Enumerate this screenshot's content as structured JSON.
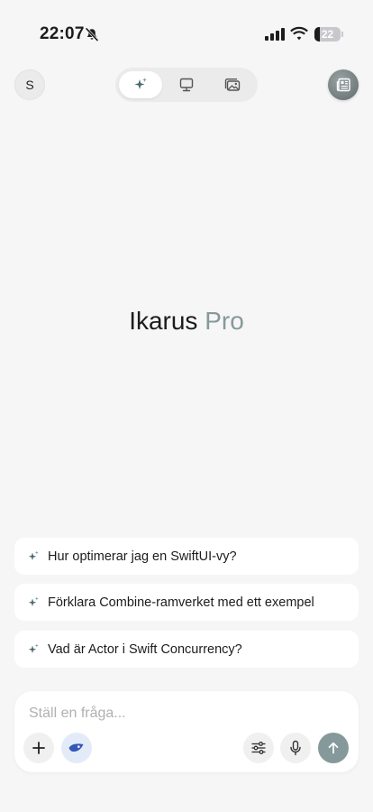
{
  "status_bar": {
    "time": "22:07",
    "battery": "22",
    "battery_level": 0.22
  },
  "header": {
    "avatar_initial": "S",
    "modes": [
      {
        "name": "chat",
        "icon": "sparkle-icon",
        "active": true
      },
      {
        "name": "desktop",
        "icon": "monitor-icon",
        "active": false
      },
      {
        "name": "images",
        "icon": "photos-icon",
        "active": false
      }
    ],
    "right_icon": "newspaper-icon"
  },
  "main": {
    "title": "Ikarus",
    "title_accent": "Pro"
  },
  "suggestions": [
    {
      "text": "Hur optimerar jag en SwiftUI-vy?"
    },
    {
      "text": "Förklara Combine-ramverket med ett exempel"
    },
    {
      "text": "Vad är Actor i Swift Concurrency?"
    }
  ],
  "composer": {
    "placeholder": "Ställ en fråga...",
    "value": "",
    "buttons": [
      "plus-icon",
      "model-icon",
      "sliders-icon",
      "microphone-icon",
      "send-arrow-icon"
    ]
  },
  "colors": {
    "background": "#f6f6f6",
    "accent": "#86999a",
    "send_button": "#86999a",
    "model_badge": "#e4ebf8",
    "model_icon": "#3458b8"
  }
}
